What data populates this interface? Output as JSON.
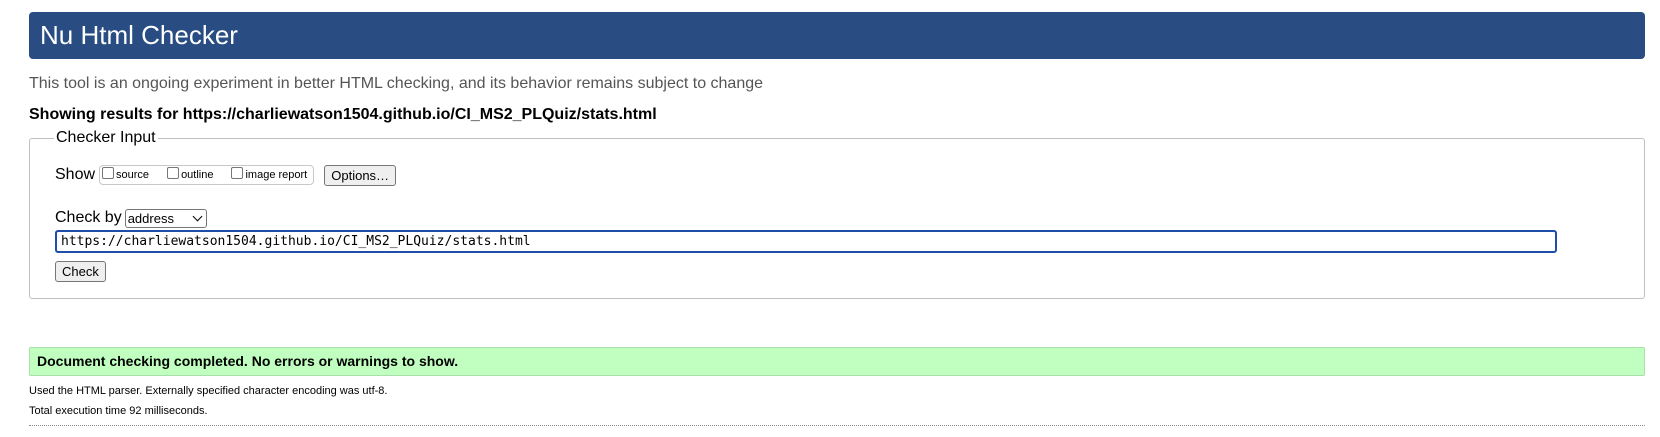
{
  "header": {
    "title": "Nu Html Checker"
  },
  "tagline": "This tool is an ongoing experiment in better HTML checking, and its behavior remains subject to change",
  "results": {
    "prefix": "Showing results for ",
    "url": "https://charliewatson1504.github.io/CI_MS2_PLQuiz/stats.html"
  },
  "checker_input": {
    "legend": "Checker Input",
    "show_label": "Show",
    "show_options": [
      {
        "label": "source",
        "checked": false
      },
      {
        "label": "outline",
        "checked": false
      },
      {
        "label": "image report",
        "checked": false
      }
    ],
    "options_button": "Options…",
    "check_by_label": "Check by",
    "check_by_selected": "address",
    "url_value": "https://charliewatson1504.github.io/CI_MS2_PLQuiz/stats.html",
    "check_button": "Check"
  },
  "status": {
    "message": "Document checking completed. No errors or warnings to show.",
    "color": "#c0ffc0"
  },
  "info": {
    "parser": "Used the HTML parser. Externally specified character encoding was utf-8.",
    "execution": "Total execution time 92 milliseconds."
  },
  "colors": {
    "header_bg": "#294d83",
    "header_text": "#ffffff",
    "input_focus": "#1f4ea8"
  }
}
